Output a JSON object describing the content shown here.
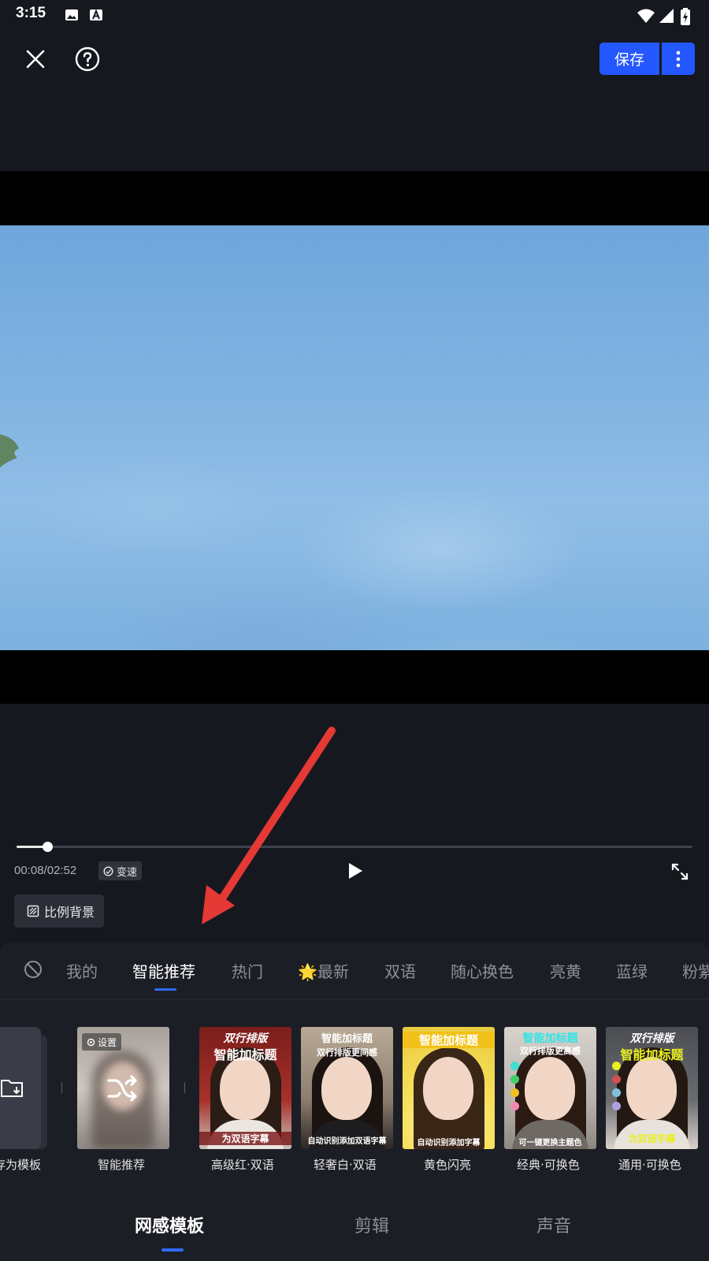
{
  "status_bar": {
    "time": "3:15"
  },
  "toolbar": {
    "save_label": "保存"
  },
  "player": {
    "time_readout": "00:08/02:52",
    "speed_label": "变速",
    "progress_fraction": 0.045,
    "ratio_bg_label": "比例背景"
  },
  "categories": [
    {
      "label": "我的",
      "active": false
    },
    {
      "label": "智能推荐",
      "active": true
    },
    {
      "label": "热门",
      "active": false
    },
    {
      "label": "🌟最新",
      "active": false
    },
    {
      "label": "双语",
      "active": false
    },
    {
      "label": "随心换色",
      "active": false
    },
    {
      "label": "亮黄",
      "active": false
    },
    {
      "label": "蓝绿",
      "active": false
    },
    {
      "label": "粉紫",
      "active": false
    }
  ],
  "templates": {
    "save_as": {
      "label": "存为模板"
    },
    "smart": {
      "label": "智能推荐",
      "settings_label": "设置"
    },
    "items": [
      {
        "label": "高级红·双语",
        "line1": "双行排版",
        "line2": "智能加标题",
        "line3": "为双语字幕"
      },
      {
        "label": "轻奢白·双语",
        "line1": "智能加标题",
        "line2": "双行排版更间感",
        "line3": "自动识别添加双语字幕"
      },
      {
        "label": "黄色闪亮",
        "line1": "智能加标题",
        "line2": "",
        "line3": "自动识别添加字幕"
      },
      {
        "label": "经典·可换色",
        "line1": "智能加标题",
        "line2": "双行排版更高感",
        "line3": "可一键更换主题色"
      },
      {
        "label": "通用·可换色",
        "line1": "双行排版",
        "line2": "智能加标题",
        "line3": "为双语字幕"
      }
    ]
  },
  "bottom_nav": {
    "tabs": [
      {
        "label": "网感模板",
        "active": true
      },
      {
        "label": "剪辑",
        "active": false
      },
      {
        "label": "声音",
        "active": false
      }
    ]
  },
  "colors": {
    "accent": "#2457ff",
    "annotation_arrow": "#e53935"
  }
}
